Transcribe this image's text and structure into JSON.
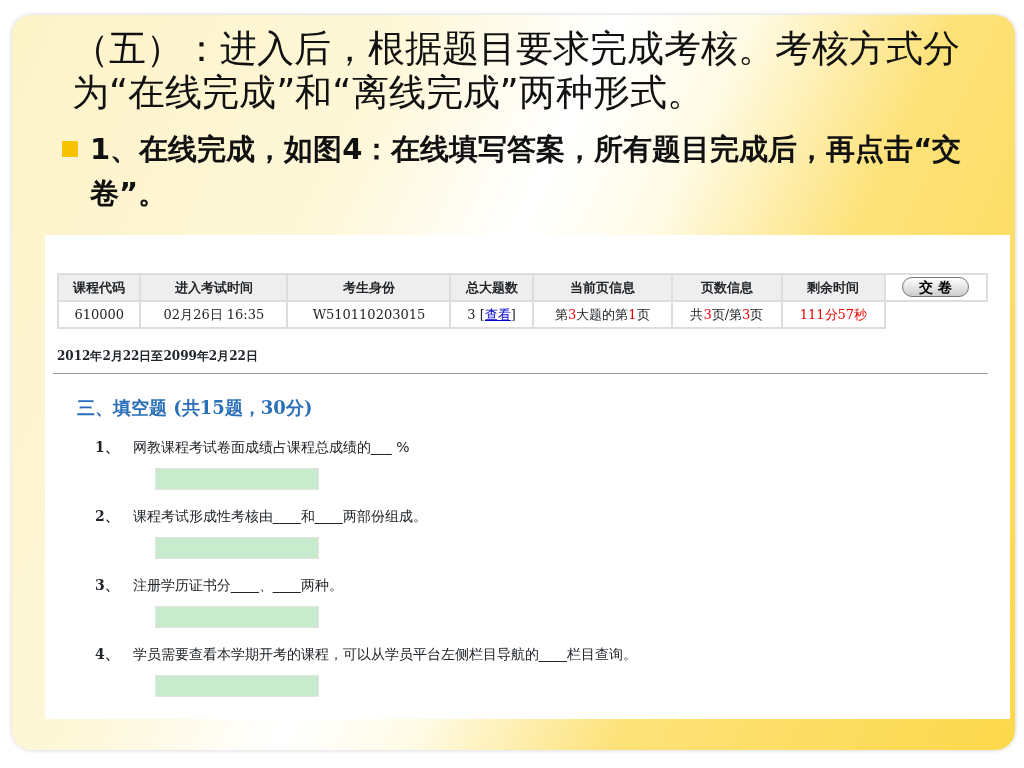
{
  "slide": {
    "title": "（五）：进入后，根据题目要求完成考核。考核方式分为“在线完成”和“离线完成”两种形式。",
    "bullet": "1、在线完成，如图4：在线填写答案，所有题目完成后，再点击“交卷”。"
  },
  "exam": {
    "columns": [
      "课程代码",
      "进入考试时间",
      "考生身份",
      "总大题数",
      "当前页信息",
      "页数信息",
      "剩余时间"
    ],
    "row": [
      [
        {
          "text": "610000"
        }
      ],
      [
        {
          "text": "02月26日  16:35"
        }
      ],
      [
        {
          "text": "W510110203015"
        }
      ],
      [
        {
          "text": "3 ["
        },
        {
          "text": "查看",
          "kind": "link"
        },
        {
          "text": "]"
        }
      ],
      [
        {
          "text": "第"
        },
        {
          "text": "3",
          "highlight": true
        },
        {
          "text": "大题的第"
        },
        {
          "text": "1",
          "highlight": true
        },
        {
          "text": "页"
        }
      ],
      [
        {
          "text": "共"
        },
        {
          "text": "3",
          "highlight": true
        },
        {
          "text": "页/第"
        },
        {
          "text": "3",
          "highlight": true
        },
        {
          "text": "页"
        }
      ],
      [
        {
          "text": "111分57秒",
          "highlight": true
        }
      ]
    ],
    "submit_button": "交 卷",
    "period": "2012年2月22日至2099年2月22日",
    "section_title": "三、填空题 (共15题，30分)",
    "questions": [
      {
        "number": "1、",
        "text": "网教课程考试卷面成绩占课程总成绩的___ %"
      },
      {
        "number": "2、",
        "text": "课程考试形成性考核由____和____两部份组成。"
      },
      {
        "number": "3、",
        "text": "注册学历证书分____、____两种。"
      },
      {
        "number": "4、",
        "text": "学员需要查看本学期开考的课程，可以从学员平台左侧栏目导航的____栏目查询。"
      }
    ]
  }
}
